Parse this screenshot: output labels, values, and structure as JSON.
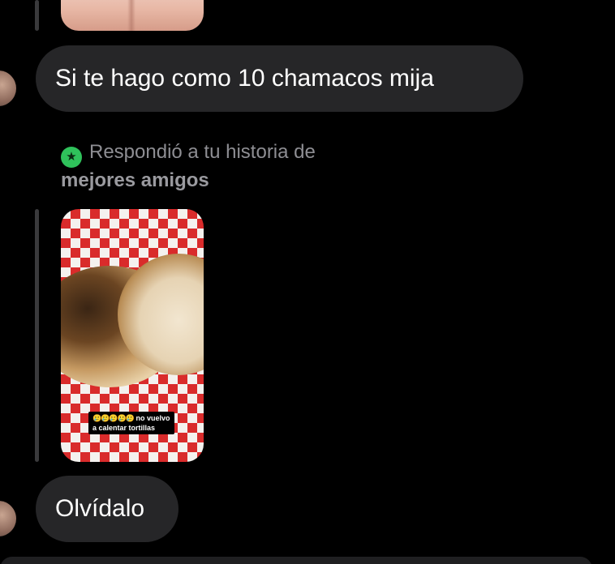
{
  "messages": [
    {
      "type": "text",
      "text": "Si te hago como 10 chamacos mija"
    },
    {
      "type": "text",
      "text": "Olvídalo"
    }
  ],
  "story_reply": {
    "label": "Respondió a tu historia de",
    "label_bold": "mejores amigos",
    "badge_icon": "star-icon",
    "badge_color": "#2fc25b",
    "story_caption_emojis": "🥲🥲🥲🥲🥲",
    "story_caption_line1": "no vuelvo",
    "story_caption_line2": "a calentar tortillas"
  },
  "colors": {
    "background": "#000000",
    "bubble": "#262628",
    "text": "#ffffff",
    "muted": "#8e8e93"
  }
}
